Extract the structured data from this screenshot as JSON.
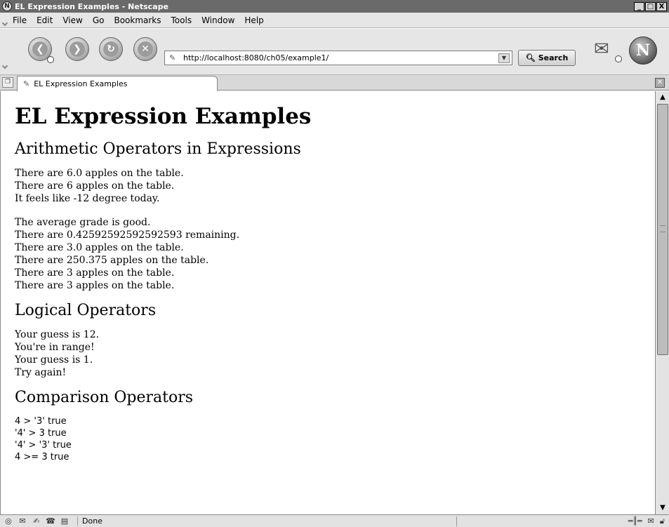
{
  "window": {
    "title": "EL Expression Examples - Netscape",
    "buttons": [
      "_",
      "□",
      "X"
    ]
  },
  "menubar": {
    "items": [
      {
        "label": "File"
      },
      {
        "label": "Edit"
      },
      {
        "label": "View"
      },
      {
        "label": "Go"
      },
      {
        "label": "Bookmarks"
      },
      {
        "label": "Tools"
      },
      {
        "label": "Window"
      },
      {
        "label": "Help"
      }
    ]
  },
  "navbar": {
    "url": "http://localhost:8080/ch05/example1/",
    "search_label": "Search",
    "throbber_letter": "N"
  },
  "tabs": [
    {
      "label": "EL Expression Examples"
    }
  ],
  "content": {
    "title": "EL Expression Examples",
    "sections": [
      {
        "heading": "Arithmetic Operators in Expressions",
        "group1": [
          "There are 6.0 apples on the table.",
          "There are 6 apples on the table.",
          "It feels like -12 degree today."
        ],
        "group2": [
          "The average grade is good.",
          "There are 0.42592592592592593 remaining.",
          "There are 3.0 apples on the table.",
          "There are 250.375 apples on the table.",
          "There are 3 apples on the table.",
          "There are 3 apples on the table."
        ]
      },
      {
        "heading": "Logical Operators",
        "lines": [
          "Your guess is 12.",
          "You're in range!",
          "Your guess is 1.",
          "Try again!"
        ]
      },
      {
        "heading": "Comparison Operators",
        "lines": [
          "4 > '3' true",
          "'4' > 3 true",
          "'4' > '3' true",
          "4 >= 3 true"
        ]
      }
    ]
  },
  "status": {
    "text": "Done"
  }
}
